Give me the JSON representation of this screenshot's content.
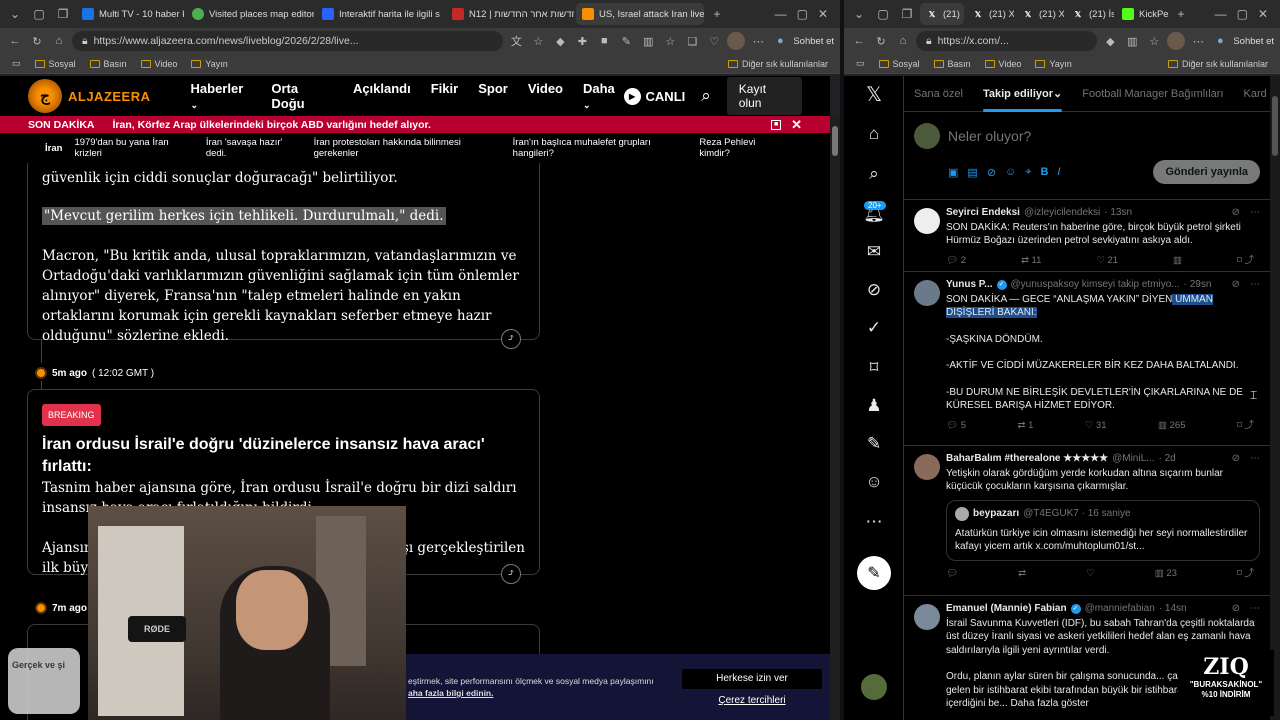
{
  "left_window": {
    "tabs": [
      {
        "label": "Multi TV - 10 haber k",
        "fav_color": "#1a73e8"
      },
      {
        "label": "Visited places map editor",
        "fav_color": "#4caf50"
      },
      {
        "label": "Interaktif harita ile ilgili s",
        "fav_color": "#2962ff"
      },
      {
        "label": "N12 | חדשות אחר החדשות",
        "fav_color": "#c62828"
      },
      {
        "label": "US, Israel attack Iran live:",
        "fav_color": "#fa9000",
        "active": true
      }
    ],
    "url": "https://www.aljazeera.com/news/liveblog/2026/2/28/live...",
    "bookmarks": [
      "Sosyal",
      "Basın",
      "Video",
      "Yayın"
    ],
    "bookmarks_right": "Diğer sık kullanılanlar",
    "profile_label": "Sohbet et"
  },
  "right_window": {
    "tabs": [
      "(21)",
      "(21) X F",
      "(21) X F",
      "(21) İsr",
      "KickPe"
    ],
    "url": "https://x.com/...",
    "bookmarks": [
      "Sosyal",
      "Basın",
      "Video",
      "Yayın"
    ],
    "bookmarks_right": "Diğer sık kullanılanlar",
    "profile_label": "Sohbet et"
  },
  "aljazeera": {
    "logo": "ALJAZEERA",
    "nav": [
      "Haberler",
      "Orta Doğu",
      "Açıklandı",
      "Fikir",
      "Spor",
      "Video",
      "Daha"
    ],
    "live": "CANLI",
    "subscribe": "Kayıt olun",
    "breaking_label": "SON DAKİKA",
    "breaking_text": "İran, Körfez Arap ülkelerindeki birçok ABD varlığını hedef alıyor.",
    "topic_lead": "İran",
    "topics": [
      "1979'dan bu yana İran krizleri",
      "İran 'savaşa hazır' dedi.",
      "İran protestoları hakkında bilinmesi gerekenler",
      "İran'ın başlıca muhalefet grupları hangileri?",
      "Reza Pehlevi kimdir?"
    ],
    "card1": {
      "line1": "güvenlik için ciddi sonuçlar doğuracağı\" belirtiliyor.",
      "quote": "\"Mevcut gerilim herkes için tehlikeli. Durdurulmalı,\" dedi.",
      "para": "Macron, \"Bu kritik anda, ulusal topraklarımızın, vatandaşlarımızın ve Ortadoğu'daki varlıklarımızın güvenliğini sağlamak için tüm önlemler alınıyor\" diyerek, Fransa'nın \"talep etmeleri halinde en yakın ortaklarını korumak için gerekli kaynakları seferber etmeye hazır olduğunu\" sözlerine ekledi."
    },
    "ts1": {
      "ago": "5m ago",
      "time": "( 12:02 GMT )"
    },
    "card2": {
      "badge": "BREAKING",
      "headline": "İran ordusu İsrail'e doğru 'düzinelerce insansız hava aracı' fırlattı:",
      "para": "Tasnim haber ajansına göre, İran ordusu İsrail'e doğru bir dizi saldırı insansız hava aracı fırlatıldığını bildirdi.",
      "para2_a": "Ajansın",
      "para2_b": "ilk büyü",
      "para2_c": "arşı gerçekleştirilen"
    },
    "ts2": {
      "ago": "7m ago"
    },
    "cookie": {
      "text_a": "eştirmek, site performansını ölçmek ve sosyal medya paylaşımını",
      "text_b": "aha fazla bilgi edinin.",
      "accept": "Herkese izin ver",
      "prefs": "Çerez tercihleri"
    },
    "promo": "Gerçek ve şi",
    "mic_label": "RØDE"
  },
  "x": {
    "tabs": [
      "Sana özel",
      "Takip ediliyor",
      "Football Manager Bağımlıları",
      "Kard"
    ],
    "compose_placeholder": "Neler oluyor?",
    "post_button": "Gönderi yayınla",
    "notif_count": "20+",
    "tweets": [
      {
        "name": "Seyirci Endeksi",
        "handle": "@izleyicilendeksi",
        "time": "· 13sn",
        "avatar_color": "#f0f0f0",
        "text": "SON DAKİKA: Reuters'ın haberine göre, birçok büyük petrol şirketi Hürmüz Boğazı üzerinden petrol sevkiyatını askıya aldı.",
        "replies": "2",
        "reposts": "11",
        "likes": "21",
        "views": ""
      },
      {
        "name": "Yunus P...",
        "handle": "@yunuspaksoy kimseyi takip etmiyo...",
        "time": "· 29sn",
        "avatar_color": "#6b7a8a",
        "text_a": "SON DAKİKA — GECE “ANLAŞMA YAKIN” DİYEN",
        "text_sel": " UMMAN DIŞİŞLERİ BAKANI:",
        "lines": [
          "-ŞAŞKINA DÖNDÜM.",
          "-AKTİF VE CİDDİ MÜZAKERELER BİR KEZ DAHA BALTALANDI.",
          "-BU DURUM NE BİRLEŞİK DEVLETLER'İN ÇIKARLARINA NE DE KÜRESEL BARIŞA HİZMET EDİYOR."
        ],
        "replies": "5",
        "reposts": "1",
        "likes": "31",
        "views": "265"
      },
      {
        "name": "BaharBalım #therealone ★★★★★",
        "handle": "@MiniL...",
        "time": "· 2d",
        "avatar_color": "#8a6a5a",
        "text": "Yetişkin olarak gördüğüm yerde korkudan altına sıçarım bunlar küçücük çocukların karşısına çıkarmışlar.",
        "quote_name": "beypazarı",
        "quote_handle": "@T4EGUK7 · 16 saniye",
        "quote_text": "Atatürkün türkiye icin olmasını istemediği her seyi normallestirdiler kafayı yicem artık x.com/muhtoplum01/st...",
        "replies": "",
        "reposts": "",
        "likes": "",
        "views": "23"
      },
      {
        "name": "Emanuel (Mannie) Fabian",
        "handle": "@manniefabian",
        "time": "· 14sn",
        "avatar_color": "#7a8a9a",
        "text": "İsrail Savunma Kuvvetleri (IDF), bu sabah Tahran'da çeşitli noktalarda üst düzey İranlı siyasi ve askeri yetkilileri hedef alan eş zamanlı hava saldırılarıyla ilgili yeni ayrıntılar verdi.",
        "text2": "Ordu, planın aylar süren bir çalışma sonucunda... çalışmanın, önde gelen bir istihbarat ekibi tarafından büyük bir istihbarat operasyonunun içerdiğini be... Daha fazla göster"
      }
    ],
    "overlay": {
      "brand": "ZIQ",
      "line1": "\"BURAKSAKİNOL\"",
      "line2": "%10 İNDİRİM"
    }
  }
}
